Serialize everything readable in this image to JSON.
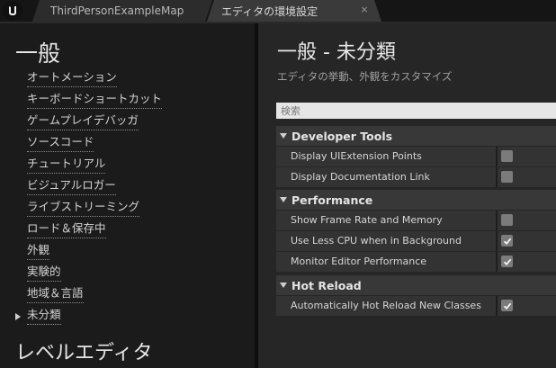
{
  "tabs": [
    {
      "label": "ThirdPersonExampleMap"
    },
    {
      "label": "エディタの環境設定",
      "close": "×"
    }
  ],
  "sidebar": {
    "section_title": "一般",
    "items": [
      {
        "label": "オートメーション"
      },
      {
        "label": "キーボードショートカット"
      },
      {
        "label": "ゲームプレイデバッガ"
      },
      {
        "label": "ソースコード"
      },
      {
        "label": "チュートリアル"
      },
      {
        "label": "ビジュアルロガー"
      },
      {
        "label": "ライブストリーミング"
      },
      {
        "label": "ロード＆保存中"
      },
      {
        "label": "外観"
      },
      {
        "label": "実験的"
      },
      {
        "label": "地域＆言語"
      },
      {
        "label": "未分類",
        "selected": true
      }
    ],
    "next_section_title": "レベルエディタ"
  },
  "main": {
    "title": "一般 - 未分類",
    "subtitle": "エディタの挙動、外観をカスタマイズ",
    "search_placeholder": "検索",
    "categories": [
      {
        "label": "Developer Tools",
        "properties": [
          {
            "label": "Display UIExtension Points",
            "checked": false
          },
          {
            "label": "Display Documentation Link",
            "checked": false
          }
        ]
      },
      {
        "label": "Performance",
        "properties": [
          {
            "label": "Show Frame Rate and Memory",
            "checked": false
          },
          {
            "label": "Use Less CPU when in Background",
            "checked": true
          },
          {
            "label": "Monitor Editor Performance",
            "checked": true
          }
        ]
      },
      {
        "label": "Hot Reload",
        "properties": [
          {
            "label": "Automatically Hot Reload New Classes",
            "checked": true
          }
        ]
      }
    ]
  },
  "icons": {
    "logo": "unreal-logo-icon",
    "close": "close-icon",
    "nav_selected": "triangle-right-icon",
    "category_expanded": "triangle-down-icon",
    "check": "checkmark-icon"
  },
  "colors": {
    "background": "#1a1a1a",
    "panel": "#262626",
    "category_header": "#383838",
    "row": "#333333",
    "checkbox": "#7b7b7b"
  }
}
